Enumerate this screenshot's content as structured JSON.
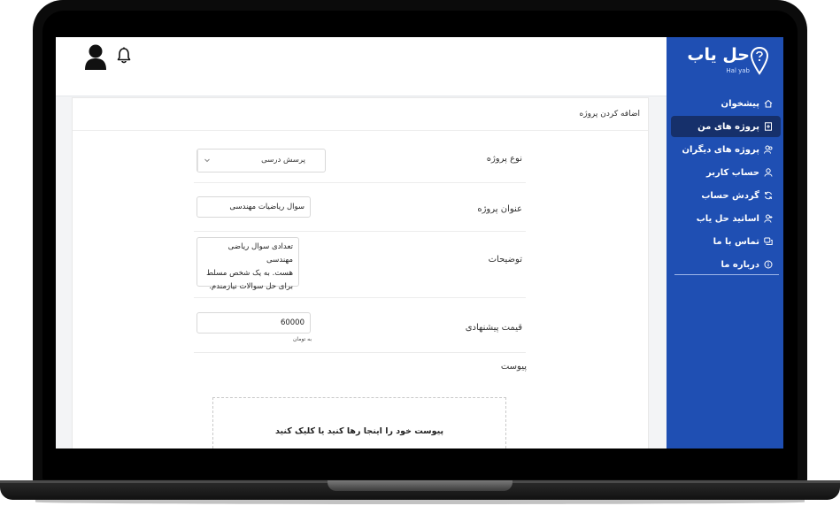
{
  "header": {
    "avatar_icon": "user-icon",
    "notification_icon": "bell-icon"
  },
  "brand": {
    "name": "حل یاب",
    "subtitle": "Hal yab",
    "color": "#1f4fb3"
  },
  "sidebar": {
    "items": [
      {
        "label": "پیشخوان",
        "icon": "home-icon"
      },
      {
        "label": "پروژه های من",
        "icon": "document-icon",
        "active": true
      },
      {
        "label": "پروژه های دیگران",
        "icon": "users-icon"
      },
      {
        "label": "حساب کاربر",
        "icon": "user-icon"
      },
      {
        "label": "گردش حساب",
        "icon": "refresh-icon"
      },
      {
        "label": "اساتید حل یاب",
        "icon": "teacher-icon"
      },
      {
        "label": "تماس با ما",
        "icon": "chat-icon"
      },
      {
        "label": "درباره ما",
        "icon": "info-icon"
      }
    ]
  },
  "form": {
    "title": "اضافه کردن پروژه",
    "project_type": {
      "label": "نوع پروژه",
      "value": "پرسش درسی"
    },
    "project_title": {
      "label": "عنوان پروژه",
      "value": "سوال ریاضیات مهندسی"
    },
    "description": {
      "label": "توضیحات",
      "lines": [
        "تعدادی سوال ریاضی مهندسی",
        "هست. به یک شخص مسلط",
        "برای حل سوالات نیازمندم."
      ]
    },
    "price": {
      "label": "قیمت پیشنهادی",
      "value": "60000",
      "unit": "به تومان"
    },
    "attachment": {
      "label": "پیوست",
      "drop_text": "پیوست خود را اینجا رها کنید یا کلیک کنید"
    }
  }
}
